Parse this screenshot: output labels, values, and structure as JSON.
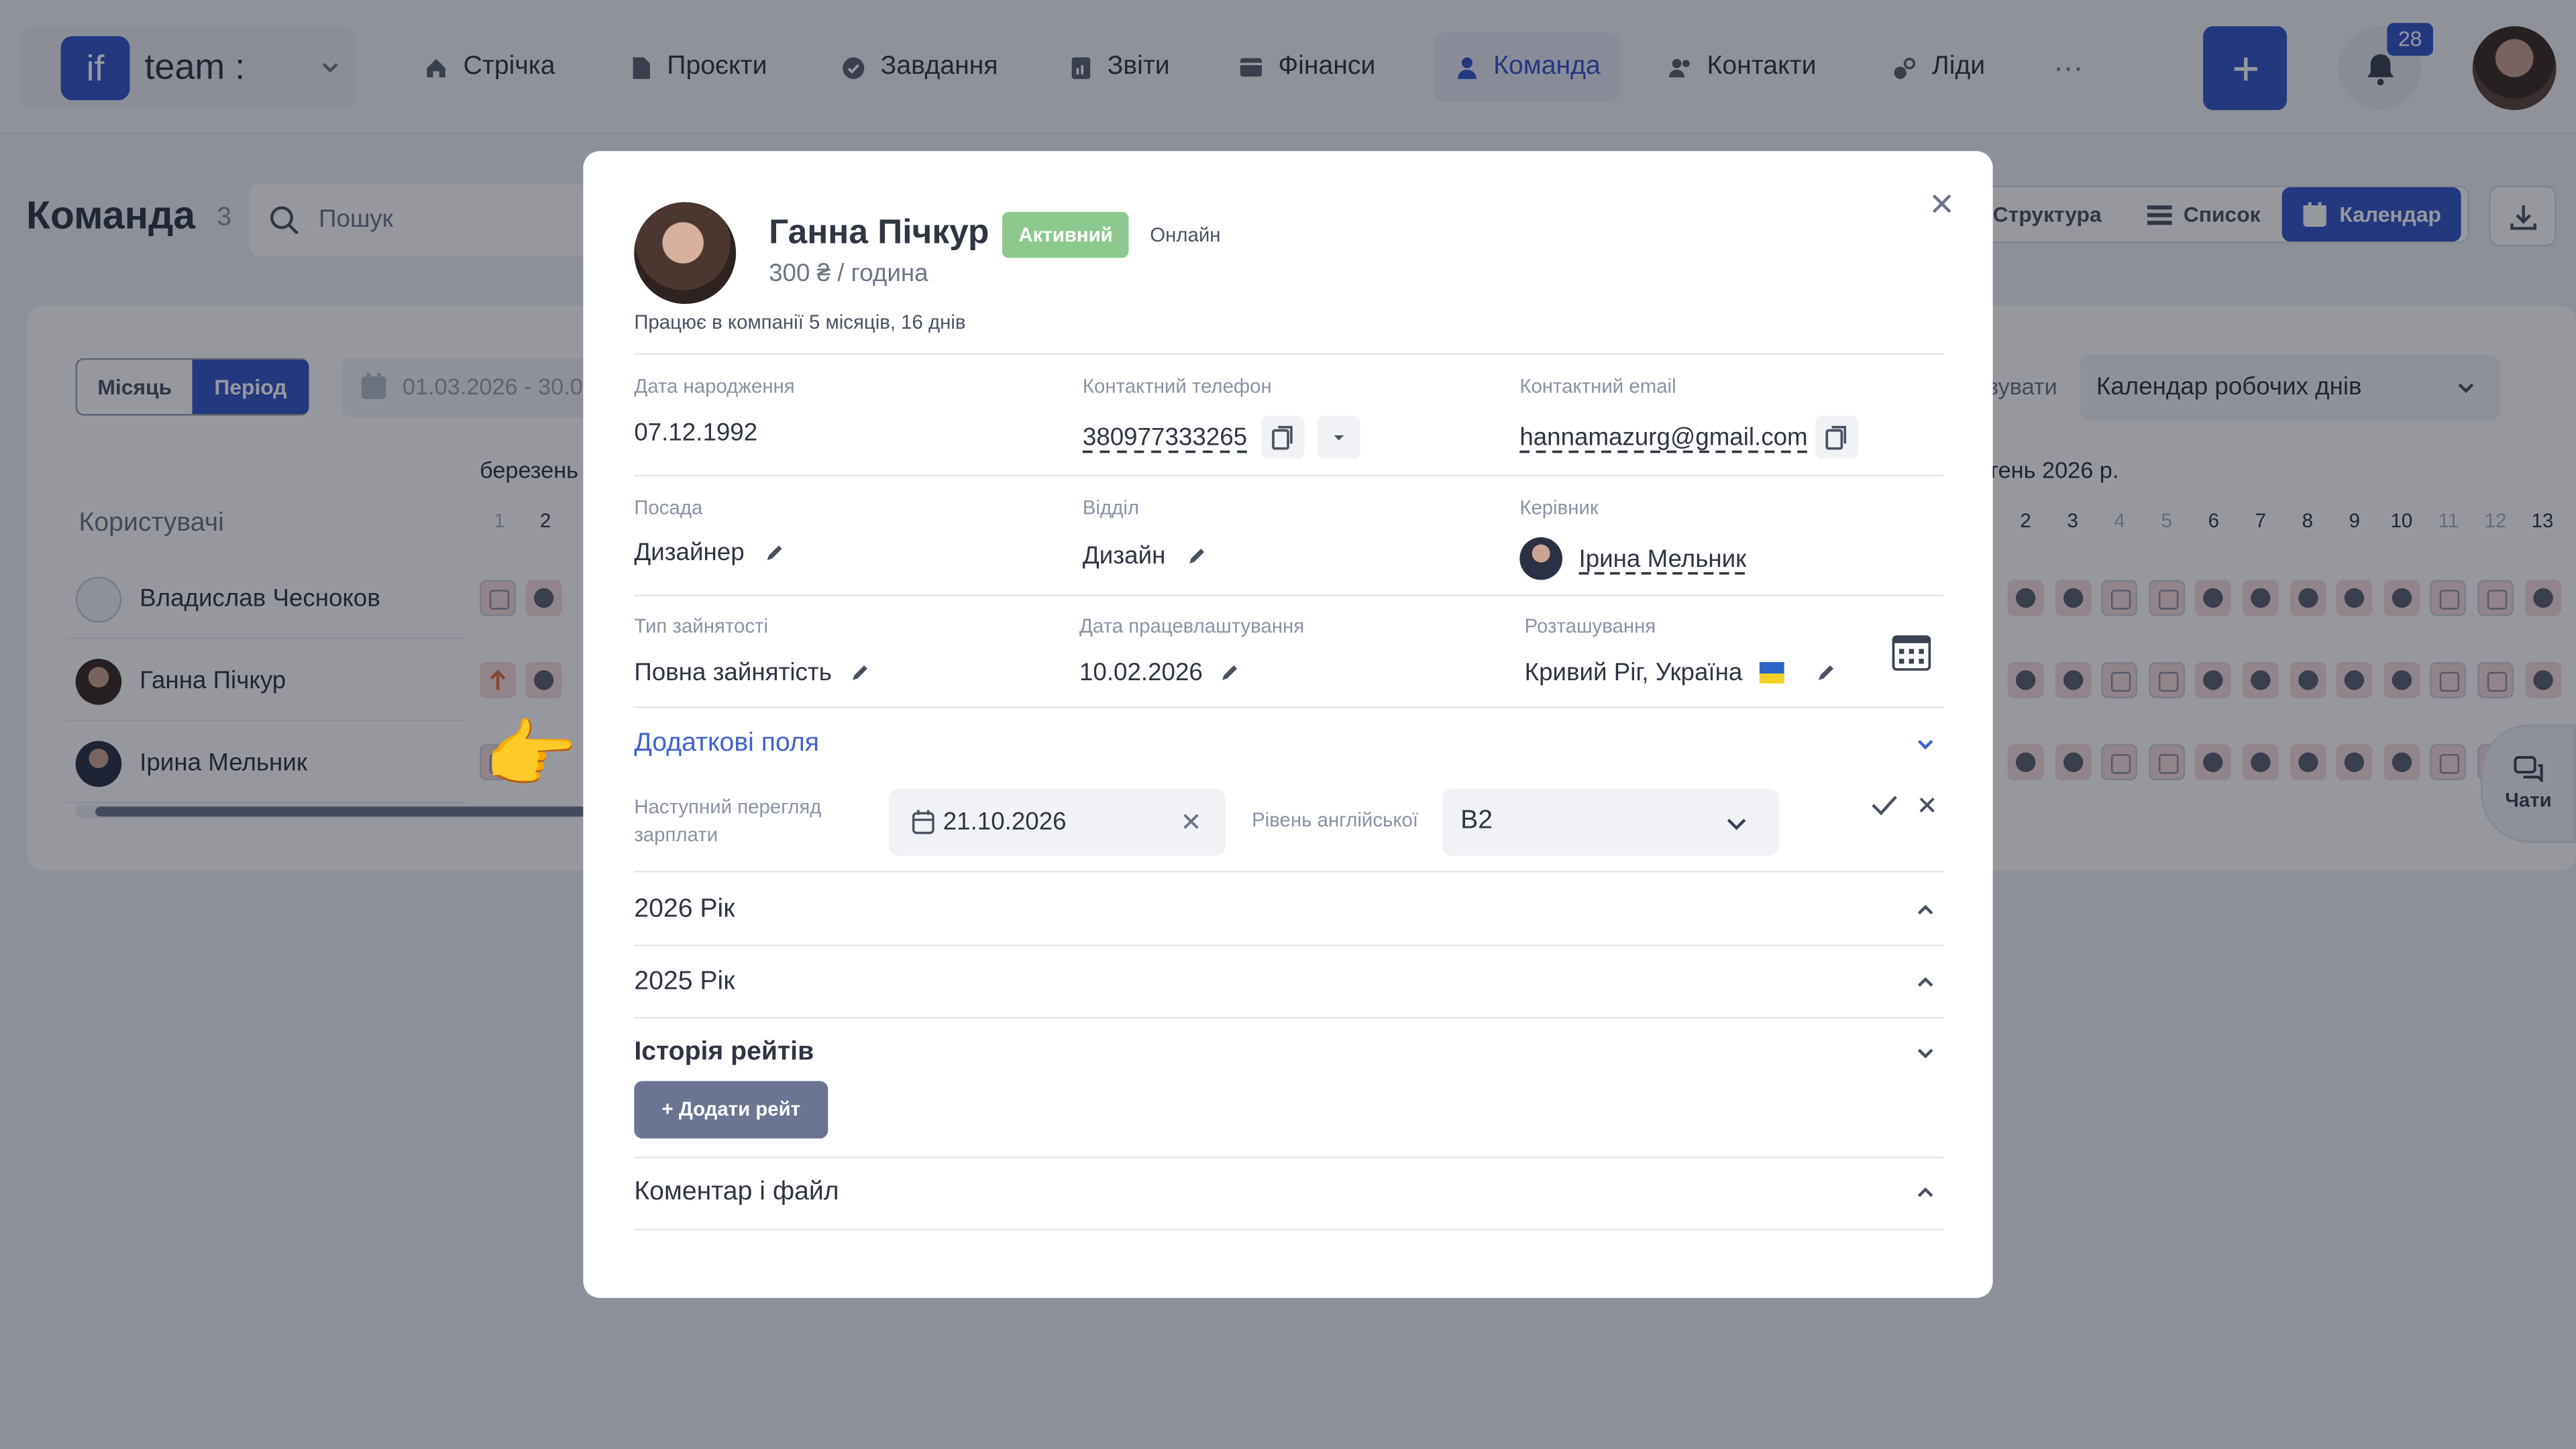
{
  "app": {
    "logo_mark": "if",
    "logo_text": "team :",
    "accent_color": "#3555c8"
  },
  "nav": {
    "items": [
      {
        "label": "Стрічка",
        "icon": "home-icon"
      },
      {
        "label": "Проєкти",
        "icon": "file-icon"
      },
      {
        "label": "Завдання",
        "icon": "check-circle-icon"
      },
      {
        "label": "Звіти",
        "icon": "report-icon"
      },
      {
        "label": "Фінанси",
        "icon": "wallet-icon"
      },
      {
        "label": "Команда",
        "icon": "user-icon",
        "active": true
      },
      {
        "label": "Контакти",
        "icon": "contacts-icon"
      },
      {
        "label": "Ліди",
        "icon": "leads-icon"
      }
    ],
    "more": "···",
    "notifications_count": "28"
  },
  "page": {
    "title": "Команда",
    "count": "3",
    "search_placeholder": "Пошук",
    "views": [
      "Структура",
      "Список",
      "Календар"
    ],
    "period_toggle": [
      "Місяць",
      "Період"
    ],
    "date_range": "01.03.2026 - 30.0",
    "month_left": "березень",
    "month_right": "тень 2026 р.",
    "users_header": "Користувачі",
    "days_left": [
      "1",
      "2"
    ],
    "days_right": [
      "2",
      "3",
      "4",
      "5",
      "6",
      "7",
      "8",
      "9",
      "10",
      "11",
      "12",
      "13"
    ],
    "users": [
      "Владислав Чесноков",
      "Ганна Пічкур",
      "Ірина Мельник"
    ],
    "filter_label": "зувати",
    "calendar_select": "Календар робочих днів",
    "chat_label": "Чати"
  },
  "modal": {
    "name": "Ганна Пічкур",
    "status": "Активний",
    "presence": "Онлайн",
    "rate": "300 ₴ / година",
    "tenure": "Працює в компанії 5 місяців, 16 днів",
    "birth_label": "Дата народження",
    "birth_value": "07.12.1992",
    "phone_label": "Контактний телефон",
    "phone_value": "380977333265",
    "email_label": "Контактний email",
    "email_value": "hannamazurg@gmail.com",
    "position_label": "Посада",
    "position_value": "Дизайнер",
    "department_label": "Відділ",
    "department_value": "Дизайн",
    "manager_label": "Керівник",
    "manager_value": "Ірина Мельник",
    "employment_label": "Тип зайнятості",
    "employment_value": "Повна зайнятість",
    "hire_label": "Дата працевлаштування",
    "hire_value": "10.02.2026",
    "location_label": "Розташування",
    "location_value": "Кривий Ріг, Україна",
    "extra_fields_title": "Додаткові поля",
    "salary_review_label": "Наступний перегляд зарплати",
    "salary_review_value": "21.10.2026",
    "english_label": "Рівень англійської",
    "english_value": "B2",
    "year_2026": "2026 Рік",
    "year_2025": "2025 Рік",
    "rates_history": "Історія рейтів",
    "add_rate": "+ Додати рейт",
    "comment_files": "Коментар і файл"
  }
}
